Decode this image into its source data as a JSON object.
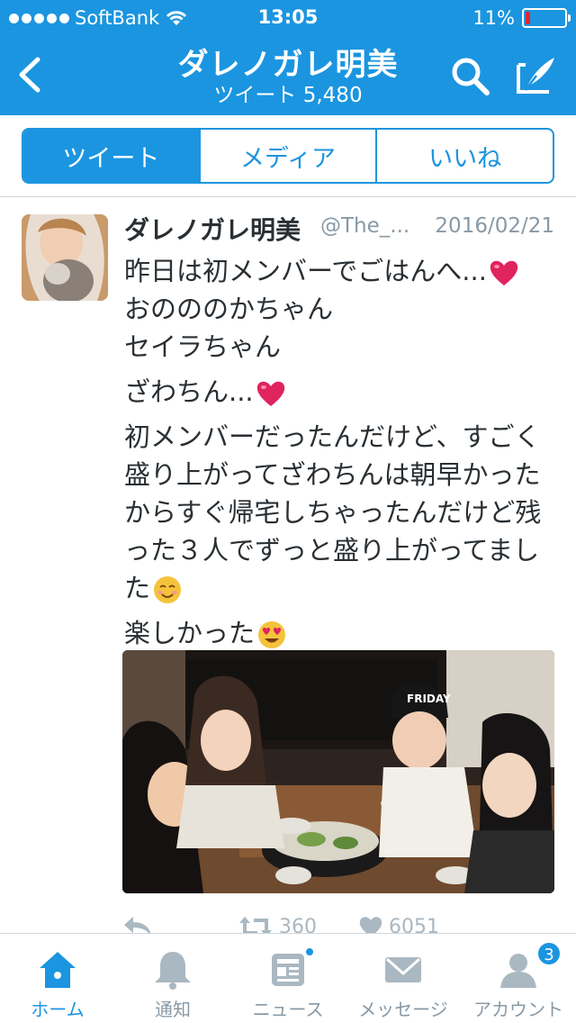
{
  "status_bar": {
    "carrier": "SoftBank",
    "time": "13:05",
    "battery": "11%",
    "battery_level": 0.11
  },
  "nav": {
    "title": "ダレノガレ明美",
    "subtitle": "ツイート 5,480"
  },
  "segments": [
    "ツイート",
    "メディア",
    "いいね"
  ],
  "tweet": {
    "name": "ダレノガレ明美",
    "handle": "@The_...",
    "date": "2016/02/21",
    "lines": [
      "昨日は初メンバーでごはんへ...",
      "おのののかちゃん",
      "セイラちゃん",
      "ざわちん...",
      "初メンバーだったんだけど、すごく",
      "盛り上がってざわちんは朝早かった",
      "からすぐ帰宅しちゃったんだけど残",
      "った３人でずっと盛り上がってまし",
      "た",
      "楽しかった"
    ],
    "photo_sign": "FRIDAY",
    "retweets": "360",
    "likes": "6051"
  },
  "tabbar": {
    "items": [
      {
        "label": "ホーム",
        "icon": "home-icon"
      },
      {
        "label": "通知",
        "icon": "bell-icon"
      },
      {
        "label": "ニュース",
        "icon": "news-icon"
      },
      {
        "label": "メッセージ",
        "icon": "envelope-icon"
      },
      {
        "label": "アカウント",
        "icon": "person-icon"
      }
    ],
    "account_badge": "3"
  },
  "colors": {
    "brand": "#1b95e0",
    "muted": "#8899a6",
    "heart": "#e0245e"
  }
}
